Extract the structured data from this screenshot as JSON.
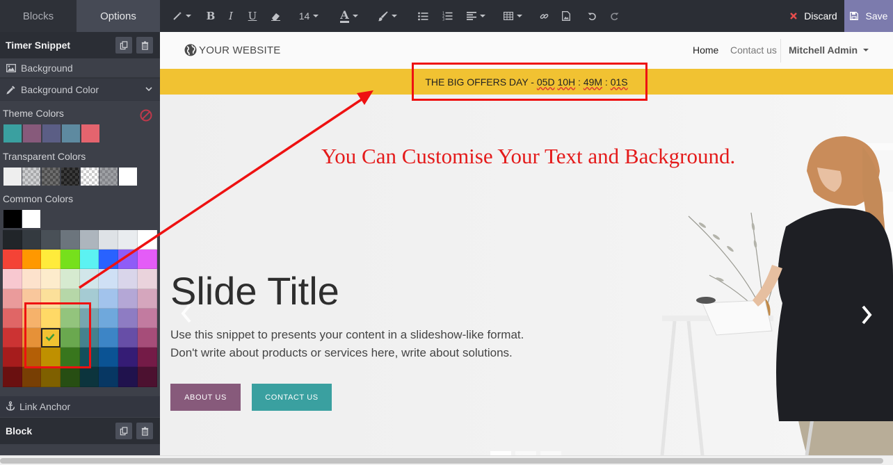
{
  "sidebar": {
    "tabs": [
      {
        "label": "Blocks"
      },
      {
        "label": "Options"
      }
    ],
    "snippet_title": "Timer Snippet",
    "options": {
      "background_label": "Background",
      "background_color_label": "Background Color"
    },
    "theme_colors_label": "Theme Colors",
    "theme_colors": [
      "#3aa0a0",
      "#875a7b",
      "#5b5e85",
      "#5e8aa0",
      "#e4646e"
    ],
    "transparent_colors_label": "Transparent Colors",
    "common_colors_label": "Common Colors",
    "common_colors_top": [
      "#000000",
      "#ffffff"
    ],
    "color_grid": [
      [
        "#212529",
        "#343a40",
        "#495057",
        "#6c757d",
        "#adb5bd",
        "#dee2e6",
        "#e9ecef",
        "#ffffff"
      ],
      [
        "#f44336",
        "#ff9800",
        "#ffeb3b",
        "#76e01c",
        "#5cf2f2",
        "#2962ff",
        "#8e5cf7",
        "#e45cf7"
      ],
      [
        "#f8c8d0",
        "#fde2cc",
        "#fdeccc",
        "#d6ead0",
        "#d2e6ea",
        "#cfe0f5",
        "#d9d5ea",
        "#ead3dc"
      ],
      [
        "#ea9b9b",
        "#f9c79c",
        "#fbe09a",
        "#b6d7a8",
        "#a5cbd3",
        "#a2c3ec",
        "#b4a7d6",
        "#d5a6bd"
      ],
      [
        "#e06666",
        "#f6b26b",
        "#ffd966",
        "#93c47d",
        "#76a5af",
        "#6fa8dc",
        "#8e7cc3",
        "#c27ba0"
      ],
      [
        "#cc3333",
        "#e69138",
        "#f1c232",
        "#6aa84f",
        "#45818e",
        "#3d85c6",
        "#674ea7",
        "#a64d79"
      ],
      [
        "#a61c1c",
        "#b45f06",
        "#bf9000",
        "#38761d",
        "#134f5c",
        "#0b5394",
        "#351c75",
        "#741b47"
      ],
      [
        "#6a1010",
        "#783f04",
        "#7f6000",
        "#274e13",
        "#0c343d",
        "#073763",
        "#20124d",
        "#4c1130"
      ]
    ],
    "selected_color": "#f1c232",
    "link_anchor_label": "Link Anchor",
    "block_label": "Block"
  },
  "toolbar": {
    "font_size": "14",
    "discard_label": "Discard",
    "save_label": "Save",
    "save_bg": "#7c7bad",
    "discard_icon_color": "#e84d4d"
  },
  "site": {
    "brand": "YOUR WEBSITE",
    "menu": [
      {
        "label": "Home"
      },
      {
        "label": "Contact us"
      }
    ],
    "user": "Mitchell Admin",
    "timer": {
      "prefix": "THE BIG OFFERS DAY - ",
      "days": "05D",
      "hours": "10H",
      "sep1": " : ",
      "minutes": "49M",
      "sep2": " : ",
      "seconds": "01S",
      "bg_color": "#f1c232"
    },
    "slide": {
      "title": "Slide Title",
      "text_line1": "Use this snippet to presents your content in a slideshow-like format.",
      "text_line2": "Don't write about products or services here, write about solutions.",
      "btn_about": "ABOUT US",
      "btn_contact": "CONTACT US",
      "btn_about_color": "#875a7b",
      "btn_contact_color": "#3aa0a0"
    }
  },
  "annotation": {
    "text": "You Can Customise Your Text and Background.",
    "color": "#e41b1b"
  }
}
